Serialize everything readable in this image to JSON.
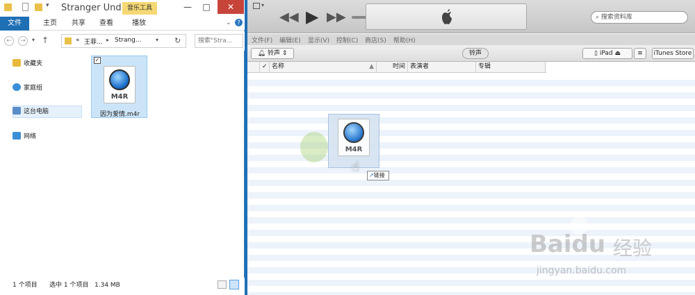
{
  "explorer": {
    "context_tab": "音乐工具",
    "title": "Stranger Und...",
    "ribbon_tabs": [
      "文件",
      "主页",
      "共享",
      "查看",
      "播放"
    ],
    "address_crumbs": [
      "«",
      "王菲...",
      "Strang..."
    ],
    "search_placeholder": "搜索\"Stra...",
    "nav": [
      {
        "label": "收藏夹",
        "icon": "star-icon"
      },
      {
        "label": "家庭组",
        "icon": "homegroup-icon"
      },
      {
        "label": "这台电脑",
        "icon": "computer-icon"
      },
      {
        "label": "网络",
        "icon": "network-icon"
      }
    ],
    "file": {
      "name": "因为爱情.m4r",
      "type_label": "M4R"
    },
    "status": {
      "count": "1 个项目",
      "selected": "选中 1 个项目",
      "size": "1.34 MB"
    }
  },
  "itunes": {
    "search_placeholder": "搜索资料库",
    "menu": [
      "文件(F)",
      "编辑(E)",
      "显示(V)",
      "控制(C)",
      "商店(S)",
      "帮助(H)"
    ],
    "library_selector": "铃声",
    "center_tab": "铃声",
    "device": "iPad",
    "store_button": "iTunes Store",
    "columns": [
      "名称",
      "时间",
      "表演者",
      "专辑"
    ],
    "drag": {
      "type_label": "M4R",
      "tooltip": "链接"
    }
  },
  "watermark": {
    "brand": "Baidu",
    "brand_cn": "经验",
    "url": "jingyan.baidu.com"
  },
  "colors": {
    "explorer_accent": "#1f6fb5",
    "close_button": "#c7443b",
    "context_tab": "#f5d873"
  }
}
